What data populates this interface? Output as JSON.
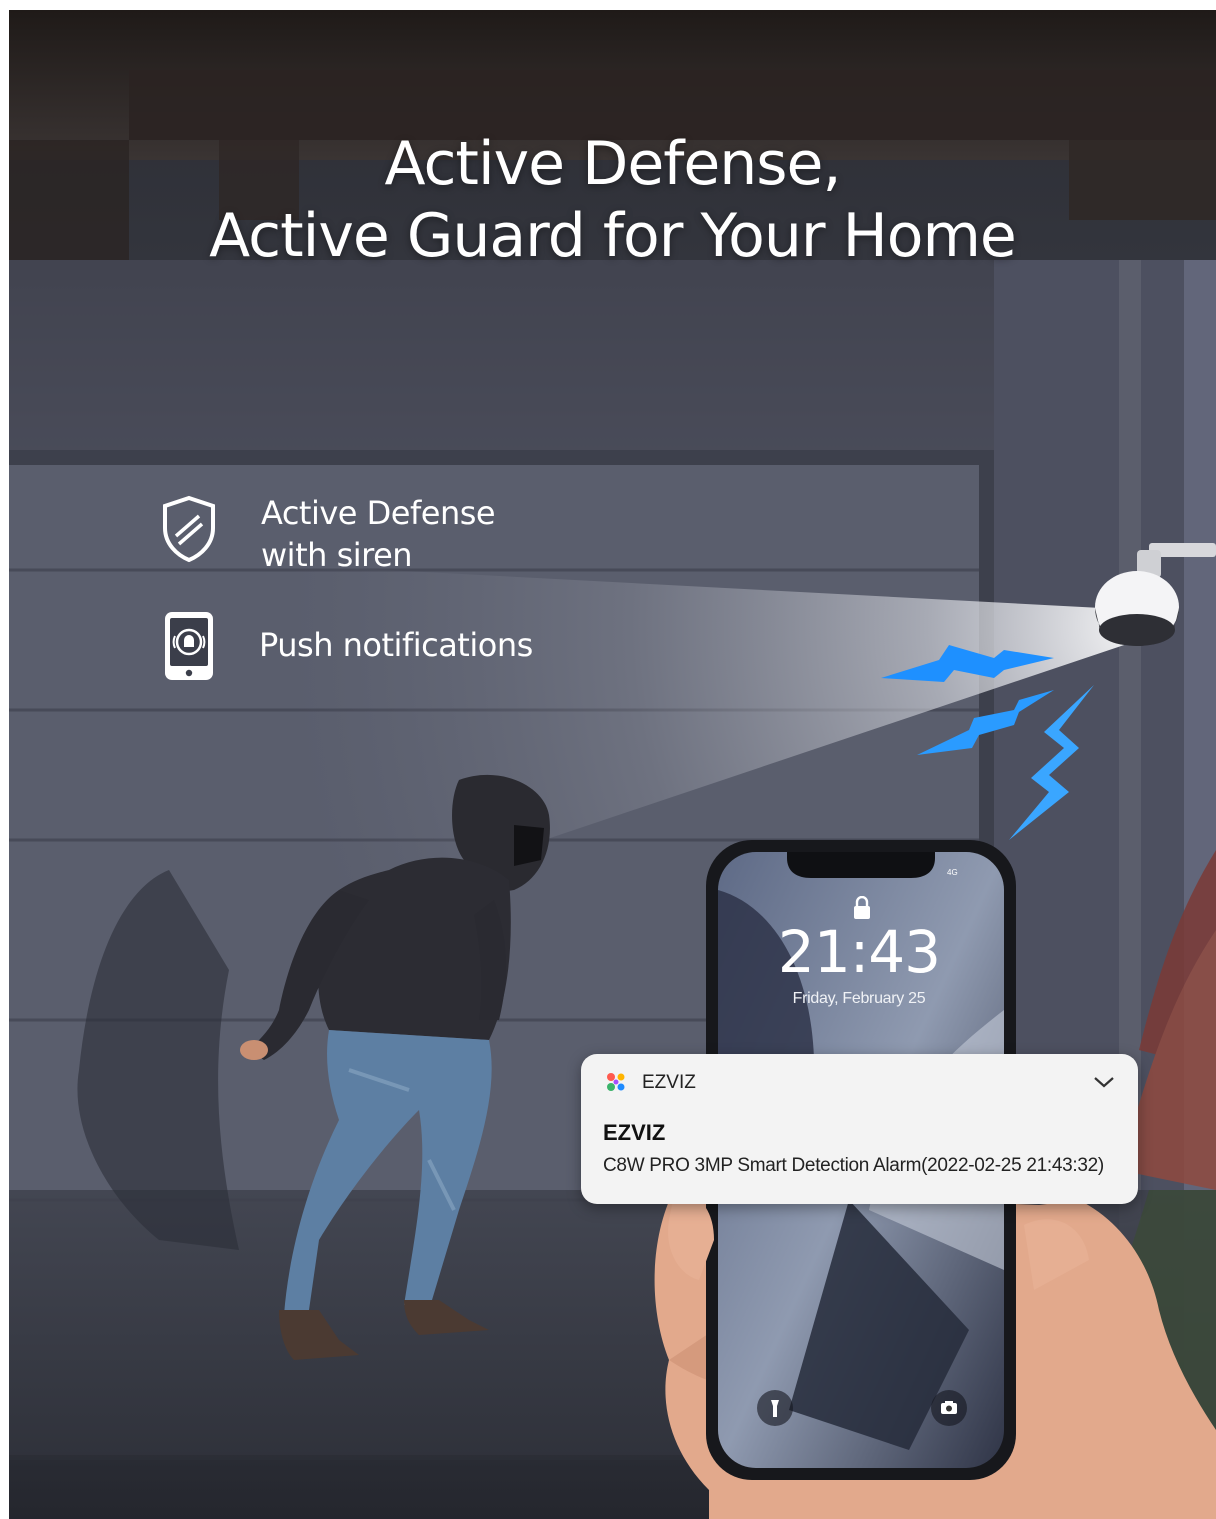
{
  "headline": {
    "line1": "Active Defense,",
    "line2": "Active Guard for Your Home"
  },
  "features": [
    {
      "icon": "shield-icon",
      "line1": "Active Defense",
      "line2": "with siren"
    },
    {
      "icon": "phone-alarm-icon",
      "line1": "Push notifications"
    }
  ],
  "phone": {
    "time": "21:43",
    "date": "Friday, February 25",
    "network": "4G",
    "lock_icon": "lock-icon",
    "flashlight_icon": "flashlight-icon",
    "camera_icon": "camera-icon"
  },
  "notification": {
    "app_name": "EZVIZ",
    "title": "EZVIZ",
    "body": "C8W PRO 3MP Smart Detection Alarm(2022-02-25 21:43:32)",
    "chevron_icon": "chevron-down-icon"
  },
  "colors": {
    "lightning": "#1e90ff",
    "text": "#ffffff",
    "notification_bg": "#f3f3f3"
  }
}
